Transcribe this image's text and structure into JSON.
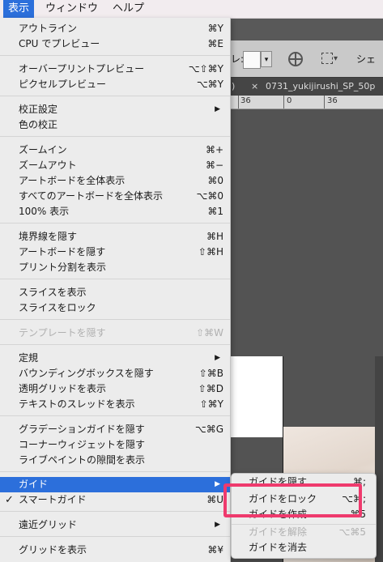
{
  "menubar": {
    "items": [
      {
        "label": "表示",
        "active": true
      },
      {
        "label": "ウィンドウ",
        "active": false
      },
      {
        "label": "ヘルプ",
        "active": false
      }
    ]
  },
  "toolbar": {
    "prefix_label": "レ:",
    "right_label": "シェ"
  },
  "tabs": [
    {
      "label": ")"
    },
    {
      "label": "×"
    },
    {
      "label": "0731_yukijirushi_SP_50p"
    }
  ],
  "ruler": {
    "labels": [
      "36",
      "0",
      "36"
    ]
  },
  "view_menu": {
    "items": [
      {
        "label": "アウトライン",
        "shortcut": "⌘Y"
      },
      {
        "label": "CPU でプレビュー",
        "shortcut": "⌘E"
      },
      {
        "label": "オーバープリントプレビュー",
        "shortcut": "⌥⇧⌘Y"
      },
      {
        "label": "ピクセルプレビュー",
        "shortcut": "⌥⌘Y"
      },
      {
        "label": "校正設定",
        "shortcut": "▶"
      },
      {
        "label": "色の校正",
        "shortcut": ""
      },
      {
        "label": "ズームイン",
        "shortcut": "⌘+"
      },
      {
        "label": "ズームアウト",
        "shortcut": "⌘−"
      },
      {
        "label": "アートボードを全体表示",
        "shortcut": "⌘0"
      },
      {
        "label": "すべてのアートボードを全体表示",
        "shortcut": "⌥⌘0"
      },
      {
        "label": "100% 表示",
        "shortcut": "⌘1"
      },
      {
        "label": "境界線を隠す",
        "shortcut": "⌘H"
      },
      {
        "label": "アートボードを隠す",
        "shortcut": "⇧⌘H"
      },
      {
        "label": "プリント分割を表示",
        "shortcut": ""
      },
      {
        "label": "スライスを表示",
        "shortcut": ""
      },
      {
        "label": "スライスをロック",
        "shortcut": ""
      },
      {
        "label": "テンプレートを隠す",
        "shortcut": "⇧⌘W"
      },
      {
        "label": "定規",
        "shortcut": "▶"
      },
      {
        "label": "バウンディングボックスを隠す",
        "shortcut": "⇧⌘B"
      },
      {
        "label": "透明グリッドを表示",
        "shortcut": "⇧⌘D"
      },
      {
        "label": "テキストのスレッドを表示",
        "shortcut": "⇧⌘Y"
      },
      {
        "label": "グラデーションガイドを隠す",
        "shortcut": "⌥⌘G"
      },
      {
        "label": "コーナーウィジェットを隠す",
        "shortcut": ""
      },
      {
        "label": "ライブペイントの隙間を表示",
        "shortcut": ""
      },
      {
        "label": "ガイド",
        "shortcut": "▶"
      },
      {
        "label": "スマートガイド",
        "shortcut": "⌘U",
        "checked": "✓"
      },
      {
        "label": "遠近グリッド",
        "shortcut": "▶"
      },
      {
        "label": "グリッドを表示",
        "shortcut": "⌘¥"
      }
    ]
  },
  "guide_submenu": {
    "items": [
      {
        "label": "ガイドを隠す",
        "shortcut": "⌘;"
      },
      {
        "label": "ガイドをロック",
        "shortcut": "⌥⌘;"
      },
      {
        "label": "ガイドを作成",
        "shortcut": "⌘5"
      },
      {
        "label": "ガイドを解除",
        "shortcut": "⌥⌘5"
      },
      {
        "label": "ガイドを消去",
        "shortcut": ""
      }
    ]
  },
  "colors": {
    "menu_highlight": "#2c6fdb",
    "annotation_box": "#ef3a6d"
  }
}
